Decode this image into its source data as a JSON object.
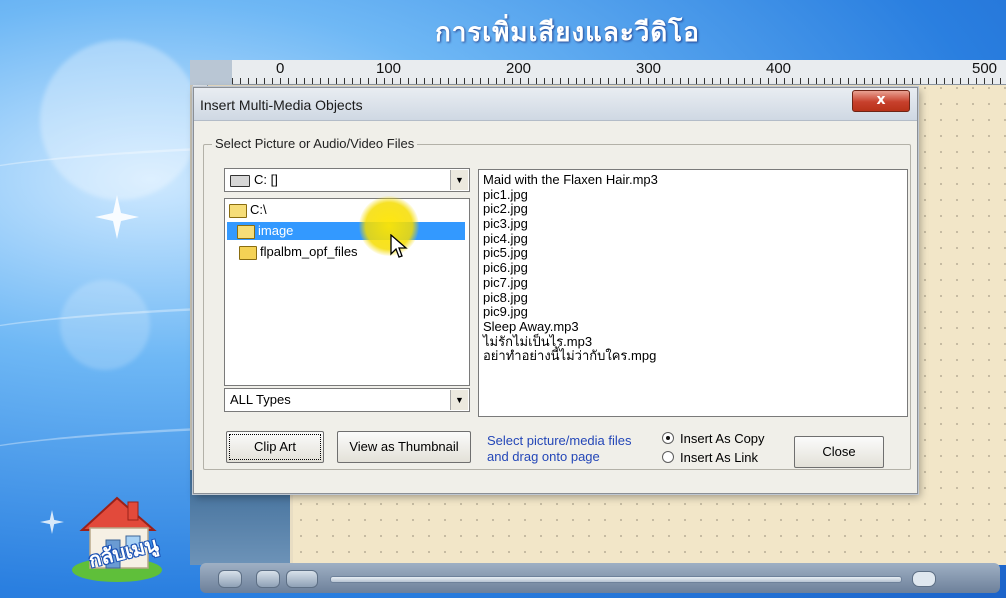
{
  "slide": {
    "title": "การเพิ่มเสียงและวีดิโอ",
    "home_label": "กลับเมนู"
  },
  "ruler": {
    "marks": [
      "0",
      "100",
      "200",
      "300",
      "400",
      "500"
    ]
  },
  "dialog": {
    "title": "Insert Multi-Media Objects",
    "close_glyph": "x",
    "group_label": "Select Picture or Audio/Video Files",
    "drive_combo": {
      "value": "C: []"
    },
    "folder_tree": [
      "C:\\",
      "image",
      "flpalbm_opf_files"
    ],
    "selected_folder": "image",
    "type_combo": {
      "value": "ALL Types"
    },
    "files": [
      "Maid with the Flaxen Hair.mp3",
      "pic1.jpg",
      "pic2.jpg",
      "pic3.jpg",
      "pic4.jpg",
      "pic5.jpg",
      "pic6.jpg",
      "pic7.jpg",
      "pic8.jpg",
      "pic9.jpg",
      "Sleep Away.mp3",
      "ไม่รักไม่เป็นไร.mp3",
      "อย่าทำอย่างนี้ไม่ว่ากับใคร.mpg"
    ],
    "buttons": {
      "clip_art": "Clip Art",
      "view_thumbnail": "View as Thumbnail",
      "close": "Close"
    },
    "hint_line1": "Select picture/media files",
    "hint_line2": "and drag onto page",
    "radio": {
      "insert_copy": "Insert As Copy",
      "insert_link": "Insert As Link",
      "selected": "insert_copy"
    }
  },
  "colors": {
    "accent": "#2a7fe0",
    "hint_text": "#2447b8",
    "title_close": "#c7402c"
  }
}
